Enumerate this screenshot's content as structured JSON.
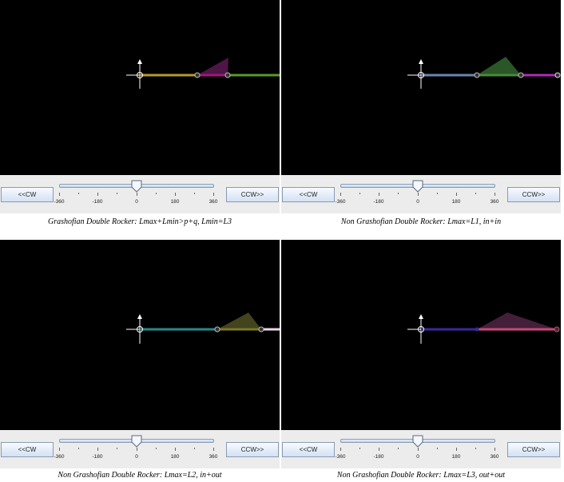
{
  "panels": [
    {
      "cw_label": "<<CW",
      "ccw_label": "CCW>>",
      "tick_labels": [
        "-360",
        "-180",
        "0",
        "180",
        "360"
      ],
      "slider_value_deg": 0,
      "caption": "Grashofian Double Rocker: Lmax+Lmin>p+q, Lmin=L3",
      "colors": {
        "link1": "#b79a2a",
        "link2": "#a0187a",
        "link3": "#5a9a2a",
        "coupler": "#7a1a6a"
      }
    },
    {
      "cw_label": "<<CW",
      "ccw_label": "CCW>>",
      "tick_labels": [
        "-360",
        "-180",
        "0",
        "180",
        "360"
      ],
      "slider_value_deg": 0,
      "caption": "Non Grashofian Double Rocker: Lmax=L1,    in+in",
      "colors": {
        "link1": "#6a86b0",
        "link2": "#4a8a3a",
        "link3": "#b02ab8",
        "coupler": "#3f7a3a"
      }
    },
    {
      "cw_label": "<<CW",
      "ccw_label": "CCW>>",
      "tick_labels": [
        "-360",
        "-180",
        "0",
        "180",
        "360"
      ],
      "slider_value_deg": 0,
      "caption": "Non Grashofian Double Rocker: Lmax=L2,     in+out",
      "colors": {
        "link1": "#2a8a8a",
        "link2": "#7a7a2a",
        "link3": "#e8d8e8",
        "coupler": "#6a6a2a"
      }
    },
    {
      "cw_label": "<<CW",
      "ccw_label": "CCW>>",
      "tick_labels": [
        "-360",
        "-180",
        "0",
        "180",
        "360"
      ],
      "slider_value_deg": 0,
      "caption": "Non Grashofian Double Rocker: Lmax=L3,     out+out",
      "colors": {
        "link1": "#3a2a9a",
        "link2": "#c84a7a",
        "link3": "#c84a7a",
        "coupler": "#5a2a4a"
      }
    }
  ]
}
